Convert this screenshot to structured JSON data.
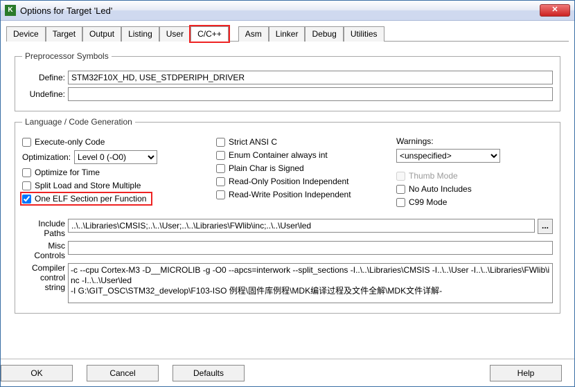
{
  "window": {
    "title": "Options for Target 'Led'"
  },
  "tabs": {
    "items": [
      "Device",
      "Target",
      "Output",
      "Listing",
      "User",
      "C/C++",
      "Asm",
      "Linker",
      "Debug",
      "Utilities"
    ],
    "active_index": 5,
    "highlight_index": 5
  },
  "preproc": {
    "legend": "Preprocessor Symbols",
    "define_label": "Define:",
    "define_value": "STM32F10X_HD, USE_STDPERIPH_DRIVER",
    "undefine_label": "Undefine:",
    "undefine_value": ""
  },
  "langgen": {
    "legend": "Language / Code Generation",
    "exec_only": {
      "label": "Execute-only Code",
      "checked": false
    },
    "optimization_label": "Optimization:",
    "optimization_value": "Level 0 (-O0)",
    "optimize_time": {
      "label": "Optimize for Time",
      "checked": false
    },
    "split_load": {
      "label": "Split Load and Store Multiple",
      "checked": false
    },
    "one_elf": {
      "label": "One ELF Section per Function",
      "checked": true
    },
    "strict_ansi": {
      "label": "Strict ANSI C",
      "checked": false
    },
    "enum_container": {
      "label": "Enum Container always int",
      "checked": false
    },
    "plain_char": {
      "label": "Plain Char is Signed",
      "checked": false
    },
    "ro_pi": {
      "label": "Read-Only Position Independent",
      "checked": false
    },
    "rw_pi": {
      "label": "Read-Write Position Independent",
      "checked": false
    },
    "warnings_label": "Warnings:",
    "warnings_value": "<unspecified>",
    "thumb_mode": {
      "label": "Thumb Mode",
      "checked": false,
      "enabled": false
    },
    "no_auto_inc": {
      "label": "No Auto Includes",
      "checked": false
    },
    "c99": {
      "label": "C99 Mode",
      "checked": false
    }
  },
  "paths": {
    "include_label": "Include Paths",
    "include_value": "..\\..\\Libraries\\CMSIS;..\\..\\User;..\\..\\Libraries\\FWlib\\inc;..\\..\\User\\led",
    "misc_label": "Misc Controls",
    "misc_value": "",
    "ccs_label": "Compiler control string",
    "ccs_value": "-c --cpu Cortex-M3 -D__MICROLIB -g -O0 --apcs=interwork --split_sections -I..\\..\\Libraries\\CMSIS -I..\\..\\User -I..\\..\\Libraries\\FWlib\\inc -I..\\..\\User\\led\n-I G:\\GIT_OSC\\STM32_develop\\F103-ISO 例程\\固件库例程\\MDK编译过程及文件全解\\MDK文件详解-"
  },
  "buttons": {
    "ok": "OK",
    "cancel": "Cancel",
    "defaults": "Defaults",
    "help": "Help"
  }
}
